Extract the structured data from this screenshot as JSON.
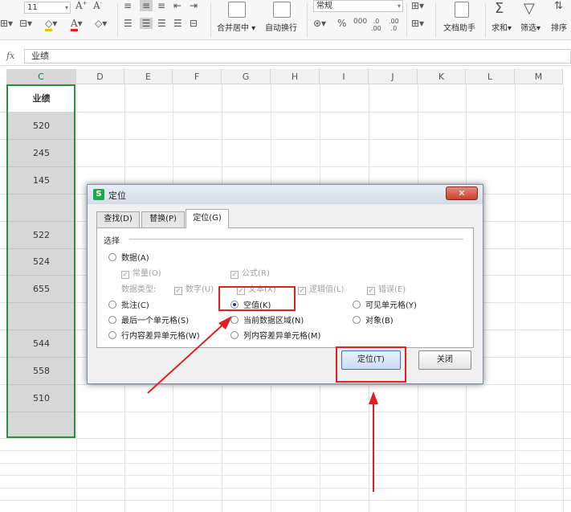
{
  "ribbon": {
    "font_size": "11",
    "number_format": "常规",
    "merge_center": "合并居中",
    "auto_wrap": "自动换行",
    "doc_helper": "文档助手",
    "sum": "求和",
    "filter": "筛选",
    "sort": "排序"
  },
  "formula_bar": {
    "fx": "fx",
    "value": "业绩"
  },
  "columns": [
    "C",
    "D",
    "E",
    "F",
    "G",
    "H",
    "I",
    "J",
    "K",
    "L",
    "M"
  ],
  "column_c": {
    "header": "业绩",
    "cells": [
      "520",
      "245",
      "145",
      "",
      "522",
      "524",
      "655",
      "",
      "544",
      "558",
      "510",
      ""
    ]
  },
  "dialog": {
    "title": "定位",
    "close_glyph": "✕",
    "tabs": [
      "查找(D)",
      "替换(P)",
      "定位(G)"
    ],
    "group_label": "选择",
    "options": {
      "data": "数据(A)",
      "constant": "常量(O)",
      "formula": "公式(R)",
      "data_type_label": "数据类型:",
      "number": "数字(U)",
      "text": "文本(X)",
      "logical": "逻辑值(L)",
      "error": "错误(E)",
      "comment": "批注(C)",
      "blank": "空值(K)",
      "visible_cells": "可见单元格(Y)",
      "last_cell": "最后一个单元格(S)",
      "current_region": "当前数据区域(N)",
      "objects": "对象(B)",
      "row_diff": "行内容差异单元格(W)",
      "col_diff": "列内容差异单元格(M)"
    },
    "goto_button": "定位(T)",
    "close_button": "关闭"
  },
  "colors": {
    "selection": "#2e8b3d",
    "highlight": "#e02020",
    "accent": "#1ea84a"
  }
}
